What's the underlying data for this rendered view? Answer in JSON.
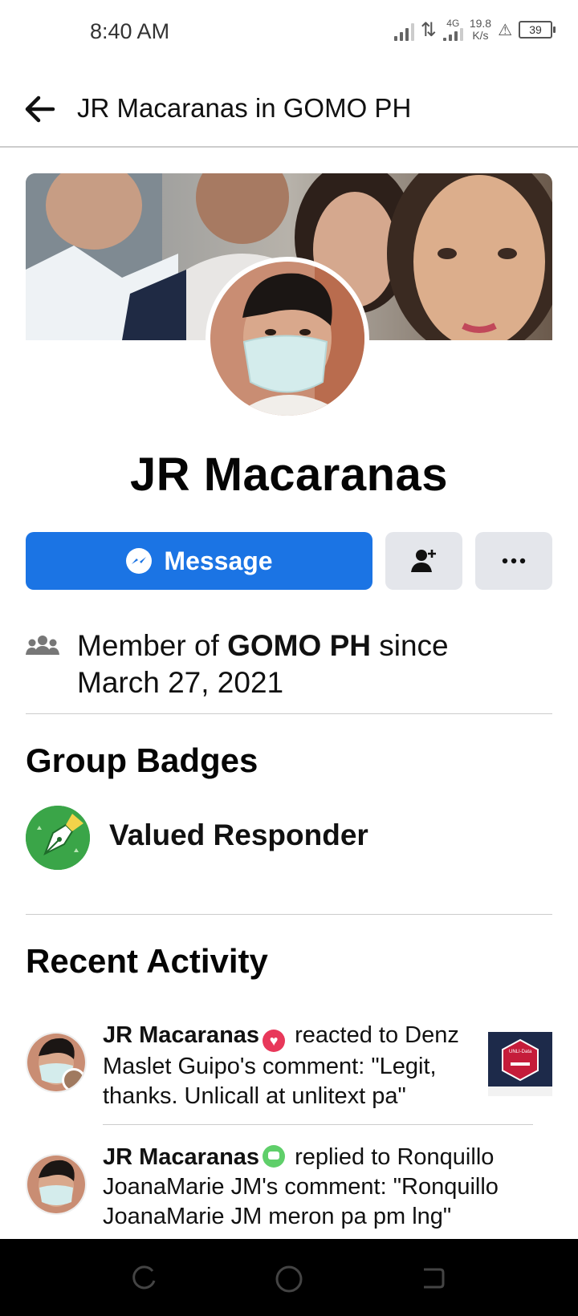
{
  "status_bar": {
    "time": "8:40 AM",
    "network_type": "4G",
    "speed_value": "19.8",
    "speed_unit": "K/s",
    "battery": "39"
  },
  "top_bar": {
    "back_icon": "arrow-left-icon",
    "title": "JR Macaranas in GOMO PH"
  },
  "profile": {
    "name": "JR Macaranas",
    "message_label": "Message",
    "add_friend_icon": "add-friend-icon",
    "more_icon": "more-dots-icon"
  },
  "membership": {
    "icon": "group-members-icon",
    "prefix": "Member of ",
    "group": "GOMO PH",
    "suffix": " since",
    "date": "March 27, 2021"
  },
  "badges": {
    "title": "Group Badges",
    "items": [
      {
        "label": "Valued Responder",
        "icon": "pen-nib-badge-icon"
      }
    ]
  },
  "recent_activity": {
    "title": "Recent Activity",
    "items": [
      {
        "actor": "JR Macaranas",
        "reaction_icon": "heart-reaction-icon",
        "text": " reacted to Denz Maslet Guipo's comment: \"Legit, thanks. Unlicall at unlitext pa\"",
        "thumbnail_text": "UNLI-Data"
      },
      {
        "actor": "JR Macaranas",
        "reaction_icon": "comment-icon",
        "text": " replied to Ronquillo JoanaMarie JM's comment: \"Ronquillo JoanaMarie JM meron pa pm lng\""
      }
    ]
  },
  "colors": {
    "accent": "#1b74e4",
    "button_grey": "#e4e6eb",
    "badge_green": "#3aa548",
    "heart": "#e8385a"
  }
}
